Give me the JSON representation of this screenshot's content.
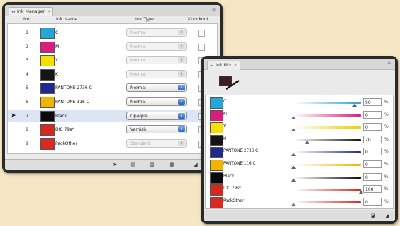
{
  "ink_manager": {
    "tab_label": "Ink Manager",
    "columns": {
      "no": "No.",
      "name": "Ink Name",
      "type": "Ink Type",
      "knockout": "Knockout"
    },
    "rows": [
      {
        "no": "1",
        "name": "C",
        "color": "#27a4d8",
        "type": "Normal",
        "enabled": false
      },
      {
        "no": "2",
        "name": "M",
        "color": "#d81f7c",
        "type": "Normal",
        "enabled": false
      },
      {
        "no": "3",
        "name": "Y",
        "color": "#f4e000",
        "type": "Normal",
        "enabled": false
      },
      {
        "no": "4",
        "name": "K",
        "color": "#151515",
        "type": "Normal",
        "enabled": false
      },
      {
        "no": "5",
        "name": "PANTONE 2736 C",
        "color": "#1f2a8c",
        "type": "Normal",
        "enabled": true
      },
      {
        "no": "6",
        "name": "PANTONE 116 C",
        "color": "#f2b400",
        "type": "Normal",
        "enabled": true
      },
      {
        "no": "7",
        "name": "Black",
        "color": "#0a0a0a",
        "type": "Opaque",
        "enabled": true
      },
      {
        "no": "8",
        "name": "DIC 79s*",
        "color": "#d8271d",
        "type": "Varnish",
        "enabled": true
      },
      {
        "no": "9",
        "name": "PackOther",
        "color": "#d92a22",
        "type": "Standard",
        "enabled": false
      }
    ],
    "selected_row_index": 6
  },
  "ink_mix": {
    "tab_label": "Ink Mix",
    "preview_color": "#3f1f1e",
    "rows": [
      {
        "name": "C",
        "color": "#27a4d8",
        "value": "90",
        "fraction": 0.9,
        "slider": [
          "#ffffff",
          "#27a4d8"
        ]
      },
      {
        "name": "M",
        "color": "#d81f7c",
        "value": "0",
        "fraction": 0.0,
        "slider": [
          "#ffffff",
          "#d81f7c"
        ]
      },
      {
        "name": "Y",
        "color": "#f4e000",
        "value": "0",
        "fraction": 0.0,
        "slider": [
          "#ffffff",
          "#e8d200"
        ]
      },
      {
        "name": "K",
        "color": "#151515",
        "value": "20",
        "fraction": 0.2,
        "slider": [
          "#ffffff",
          "#151515"
        ]
      },
      {
        "name": "PANTONE 2736 C",
        "color": "#1f2a8c",
        "value": "0",
        "fraction": 0.0,
        "slider": [
          "#ffffff",
          "#1f2a8c"
        ]
      },
      {
        "name": "PANTONE 116 C",
        "color": "#f2b400",
        "value": "0",
        "fraction": 0.0,
        "slider": [
          "#ffffff",
          "#f2b400"
        ]
      },
      {
        "name": "Black",
        "color": "#0a0a0a",
        "value": "0",
        "fraction": 0.0,
        "slider": [
          "#ffffff",
          "#0a0a0a"
        ]
      },
      {
        "name": "DIC 79s*",
        "color": "#d8271d",
        "value": "100",
        "fraction": 1.0,
        "slider": [
          "#ffffff",
          "#d8271d"
        ]
      },
      {
        "name": "PackOther",
        "color": "#d92a22",
        "value": "0",
        "fraction": 0.0,
        "slider": [
          "#ffffff",
          "#d92a22"
        ]
      }
    ],
    "percent_sign": "%"
  }
}
